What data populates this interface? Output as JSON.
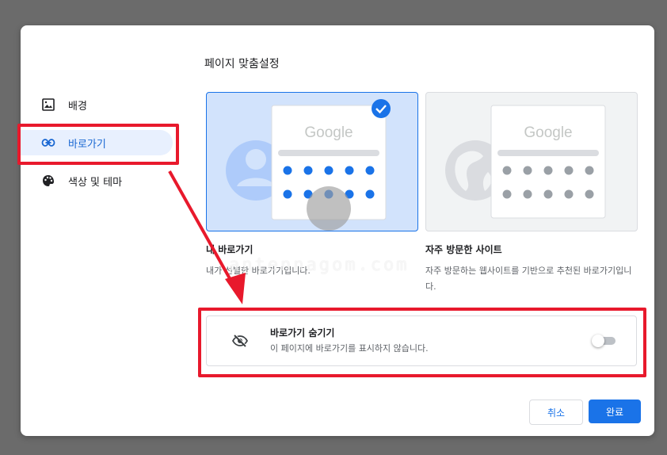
{
  "sidebar": {
    "items": [
      {
        "label": "배경",
        "icon": "image-icon",
        "active": false
      },
      {
        "label": "바로가기",
        "icon": "link-icon",
        "active": true
      },
      {
        "label": "색상 및 테마",
        "icon": "palette-icon",
        "active": false
      }
    ]
  },
  "main": {
    "title": "페이지 맞춤설정",
    "options": [
      {
        "name": "내 바로가기",
        "desc": "내가 선별한 바로가기입니다.",
        "selected": true,
        "logo": "Google"
      },
      {
        "name": "자주 방문한 사이트",
        "desc": "자주 방문하는 웹사이트를 기반으로 추천된 바로가기입니다.",
        "selected": false,
        "logo": "Google"
      }
    ],
    "hide": {
      "title": "바로가기 숨기기",
      "desc": "이 페이지에 바로가기를 표시하지 않습니다.",
      "enabled": false
    }
  },
  "buttons": {
    "cancel": "취소",
    "done": "완료"
  },
  "watermark": "antennagom.com",
  "colors": {
    "accent": "#1a73e8",
    "highlight": "#e8192c",
    "selected_bg": "#d2e3fc"
  }
}
